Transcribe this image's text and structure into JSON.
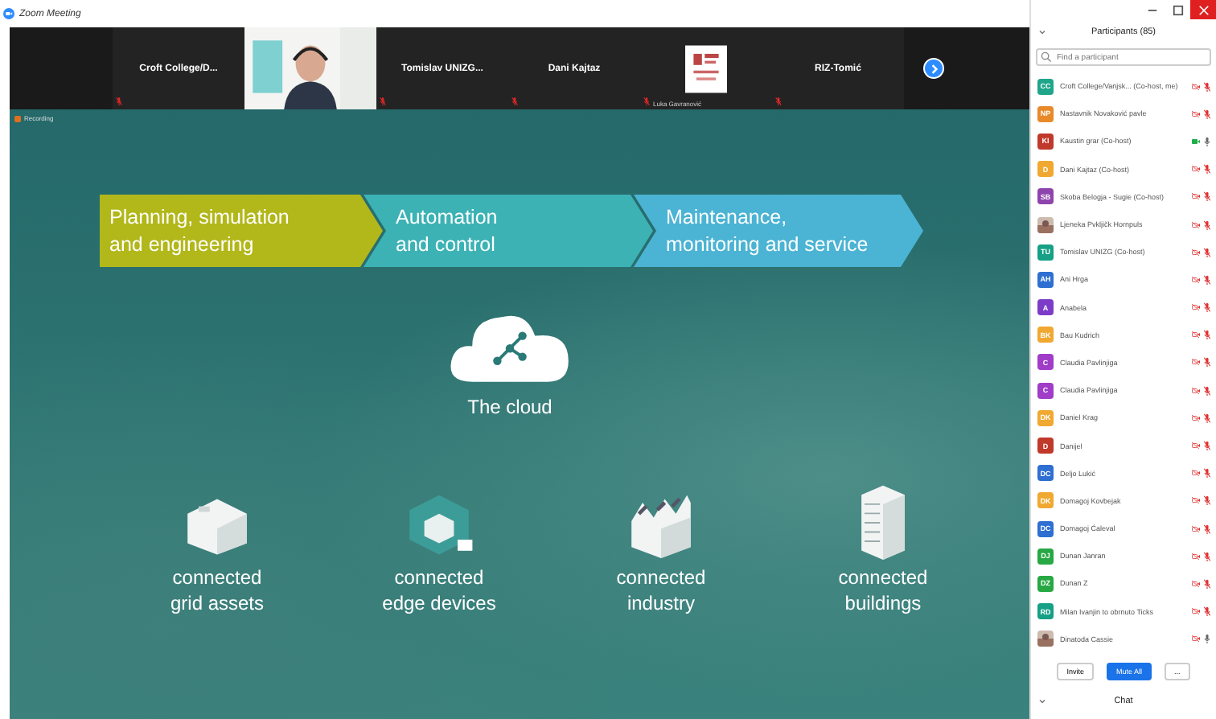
{
  "window": {
    "title": "Zoom Meeting"
  },
  "video_strip": {
    "tiles": [
      {
        "kind": "name",
        "name": "Croft  College/D...",
        "muted": true
      },
      {
        "kind": "video"
      },
      {
        "kind": "name",
        "name": "Tomislav  UNIZG...",
        "muted": true
      },
      {
        "kind": "name",
        "name": "Dani Kajtaz",
        "muted": true
      },
      {
        "kind": "logo",
        "name": "Luka Gavranović",
        "muted": true
      },
      {
        "kind": "name",
        "name": "RIZ-Tomić",
        "muted": true
      }
    ]
  },
  "share": {
    "recording": "Recording",
    "stages": [
      {
        "label": "Planning, simulation\nand engineering",
        "color": "#b2b71a"
      },
      {
        "label": "Automation\nand control",
        "color": "#3cb2b5"
      },
      {
        "label": "Maintenance,\nmonitoring and service",
        "color": "#4bb3d3"
      }
    ],
    "cloud": "The cloud",
    "nodes": [
      {
        "kind": "grid",
        "label": "connected\ngrid assets"
      },
      {
        "kind": "edge",
        "label": "connected\nedge devices"
      },
      {
        "kind": "industry",
        "label": "connected\nindustry"
      },
      {
        "kind": "buildings",
        "label": "connected\nbuildings"
      }
    ]
  },
  "participants": {
    "title": "Participants (85)",
    "search": {
      "placeholder": "Find a participant"
    },
    "items": [
      {
        "kind": "initials",
        "initials": "CC",
        "color": "#1fa58a",
        "name": "Croft College/Vanjsk... (Co-host, me)",
        "muted": true,
        "video": false
      },
      {
        "kind": "initials",
        "initials": "NP",
        "color": "#e8892a",
        "name": "Nastavnik Novaković pavle",
        "muted": true,
        "video": false
      },
      {
        "kind": "initials",
        "initials": "KI",
        "color": "#c0392b",
        "name": "Kaustin grar (Co-host)",
        "muted": false,
        "video": true
      },
      {
        "kind": "initials",
        "initials": "D",
        "color": "#f0a830",
        "name": "Dani Kajtaz (Co-host)",
        "muted": true,
        "video": false
      },
      {
        "kind": "initials",
        "initials": "SB",
        "color": "#8e44ad",
        "name": "Skoba Belogja - Sugie (Co-host)",
        "muted": true,
        "video": false
      },
      {
        "kind": "picture",
        "name": "Ljeneka Pvkljičk Hornpuls",
        "muted": true,
        "video": false
      },
      {
        "kind": "initials",
        "initials": "TU",
        "color": "#16a085",
        "name": "Tomislav UNIZG (Co-host)",
        "muted": true,
        "video": false
      },
      {
        "kind": "initials",
        "initials": "AH",
        "color": "#2e6fd1",
        "name": "Ani Hrga",
        "muted": true,
        "video": false
      },
      {
        "kind": "initials",
        "initials": "A",
        "color": "#7d3cc8",
        "name": "Anabela",
        "muted": true,
        "video": false
      },
      {
        "kind": "initials",
        "initials": "BK",
        "color": "#f0a830",
        "name": "Bau Kudrich",
        "muted": true,
        "video": false
      },
      {
        "kind": "initials",
        "initials": "C",
        "color": "#a03cc8",
        "name": "Claudia Pavlinjiga",
        "muted": true,
        "video": false
      },
      {
        "kind": "initials",
        "initials": "C",
        "color": "#a03cc8",
        "name": "Claudia Pavlinjiga",
        "muted": true,
        "video": false
      },
      {
        "kind": "initials",
        "initials": "DK",
        "color": "#f0a830",
        "name": "Daniel Krag",
        "muted": true,
        "video": false
      },
      {
        "kind": "initials",
        "initials": "D",
        "color": "#c0392b",
        "name": "Danijel",
        "muted": true,
        "video": false
      },
      {
        "kind": "initials",
        "initials": "DC",
        "color": "#2e6fd1",
        "name": "Deljo Lukić",
        "muted": true,
        "video": false
      },
      {
        "kind": "initials",
        "initials": "DK",
        "color": "#f0a830",
        "name": "Domagoj Kovbejak",
        "muted": true,
        "video": false
      },
      {
        "kind": "initials",
        "initials": "DC",
        "color": "#2e6fd1",
        "name": "Domagoj Ćaleval",
        "muted": true,
        "video": false
      },
      {
        "kind": "initials",
        "initials": "DJ",
        "color": "#27a844",
        "name": "Dunan Janran",
        "muted": true,
        "video": false
      },
      {
        "kind": "initials",
        "initials": "DZ",
        "color": "#27a844",
        "name": "Dunan Z",
        "muted": true,
        "video": false
      },
      {
        "kind": "initials",
        "initials": "RD",
        "color": "#16a085",
        "name": "Milan Ivanjin to obrnuto Ticks",
        "muted": true,
        "video": false
      },
      {
        "kind": "picture",
        "name": "Dinatoda Cassie",
        "muted": false,
        "video": false
      }
    ],
    "buttons": [
      {
        "kind": "plain",
        "label": "Invite"
      },
      {
        "kind": "primary",
        "label": "Mute All"
      },
      {
        "kind": "plain",
        "label": "..."
      }
    ]
  },
  "chat": {
    "title": "Chat"
  }
}
